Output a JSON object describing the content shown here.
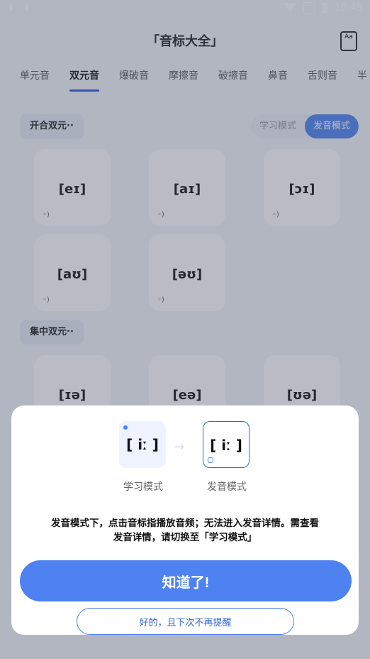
{
  "status": {
    "time": "10:49",
    "left_icons": [
      "download-icon",
      "download-icon"
    ],
    "right_icons": [
      "wifi-icon",
      "signal-icon",
      "battery-icon"
    ]
  },
  "header": {
    "title": "「音标大全」",
    "dict_button_label": "Aa"
  },
  "tabs": [
    "单元音",
    "双元音",
    "爆破音",
    "摩擦音",
    "破擦音",
    "鼻音",
    "舌则音",
    "半"
  ],
  "active_tab": "双元音",
  "sections": [
    {
      "title": "开合双元··",
      "items": [
        "[eɪ]",
        "[aɪ]",
        "[ɔɪ]",
        "[aʊ]",
        "[əʊ]"
      ]
    },
    {
      "title": "集中双元··",
      "items": [
        "[ɪə]",
        "[eə]",
        "[ʊə]"
      ]
    }
  ],
  "mode_toggle": {
    "learn": "学习模式",
    "sound": "发音模式",
    "active": "sound"
  },
  "dialog": {
    "demo_learn": "[ iː ]",
    "demo_sound": "[ iː ]",
    "demo_learn_label": "学习模式",
    "demo_sound_label": "发音模式",
    "description_line1": "发音模式下，点击音标指播放音频；无法进入发音详情。需查看",
    "description_line2": "发音详情，请切换至「学习模式」",
    "primary_button": "知道了!",
    "secondary_button": "好的，且下次不再提醒"
  },
  "colors": {
    "accent": "#4d82f0",
    "overlay": "#465064"
  }
}
